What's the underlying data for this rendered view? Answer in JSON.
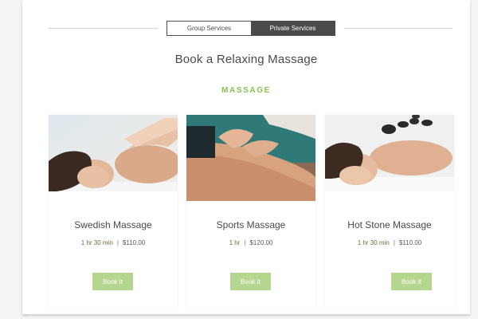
{
  "tabs": [
    {
      "label": "Group Services",
      "active": false
    },
    {
      "label": "Private Services",
      "active": true
    }
  ],
  "header": {
    "title": "Book a Relaxing Massage",
    "section_label": "MASSAGE"
  },
  "colors": {
    "accent": "#8cc152",
    "button": "#b5d68f",
    "tab_active": "#4a4a4a"
  },
  "services": [
    {
      "name": "Swedish Massage",
      "duration": "1 hr 30 min",
      "price": "$110.00",
      "button_label": "Book It",
      "image": "swedish-massage-photo"
    },
    {
      "name": "Sports Massage",
      "duration": "1 hr",
      "price": "$120.00",
      "button_label": "Book It",
      "image": "sports-massage-photo"
    },
    {
      "name": "Hot Stone Massage",
      "duration": "1 hr 30 min",
      "price": "$110.00",
      "button_label": "Book It",
      "image": "hot-stone-massage-photo"
    }
  ],
  "separator": "|"
}
